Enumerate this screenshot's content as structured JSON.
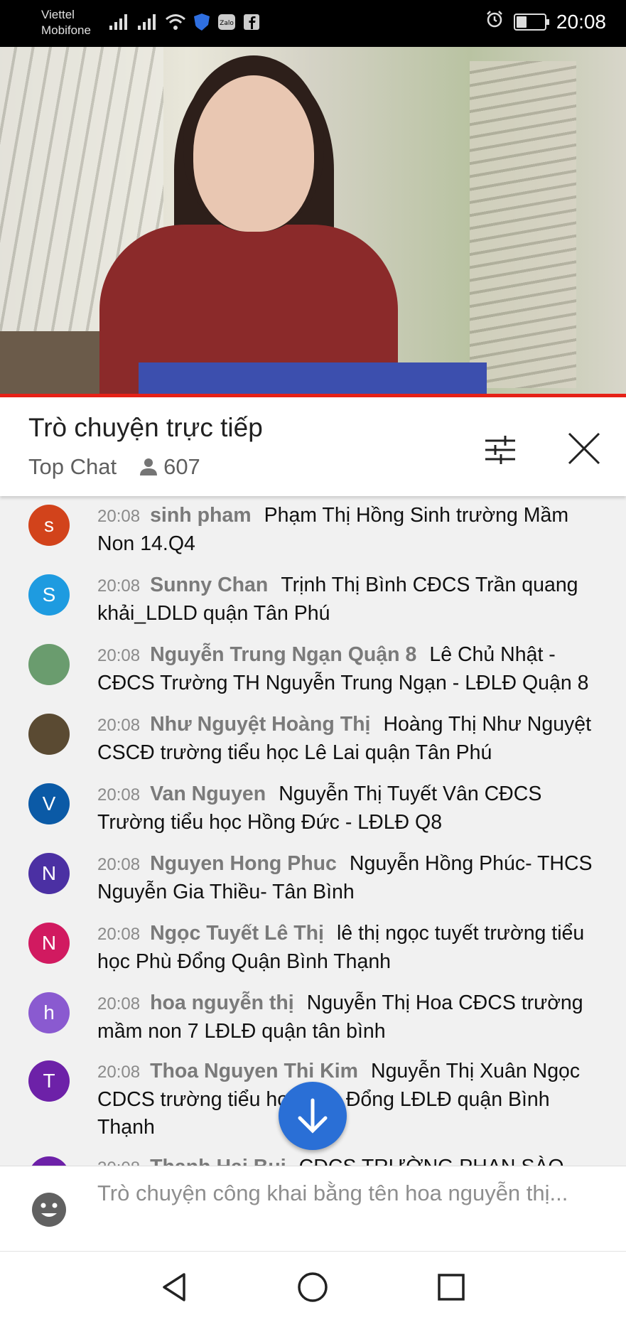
{
  "status_bar": {
    "carrier_1": "Viettel",
    "carrier_2": "Mobifone",
    "time": "20:08",
    "icons": [
      "signal-icon",
      "signal-icon",
      "wifi-icon",
      "shield-icon",
      "zalo-icon",
      "facebook-icon",
      "alarm-icon",
      "battery-icon"
    ]
  },
  "video": {
    "progress_color": "#e62117"
  },
  "chat_header": {
    "title": "Trò chuyện trực tiếp",
    "mode": "Top Chat",
    "viewer_count": "607"
  },
  "messages": [
    {
      "avatar_letter": "s",
      "avatar_color": "#d2431b",
      "time": "20:08",
      "author": "sinh pham",
      "text": "Phạm Thị Hồng Sinh trường Mầm Non 14.Q4"
    },
    {
      "avatar_letter": "S",
      "avatar_color": "#1e9be0",
      "time": "20:08",
      "author": "Sunny Chan",
      "text": "Trịnh Thị Bình CĐCS Trần quang khải_LDLD quận Tân Phú"
    },
    {
      "avatar_letter": "",
      "avatar_color": "#6a9c6e",
      "time": "20:08",
      "author": "Nguyễn Trung Ngạn Quận 8",
      "text": "Lê Chủ Nhật - CĐCS Trường TH Nguyễn Trung Ngạn - LĐLĐ Quận 8"
    },
    {
      "avatar_letter": "",
      "avatar_color": "#5a4a32",
      "time": "20:08",
      "author": "Như Nguyệt Hoàng Thị",
      "text": "Hoàng Thị Như Nguyệt CSCĐ trường tiểu học Lê Lai quận Tân Phú"
    },
    {
      "avatar_letter": "V",
      "avatar_color": "#0b5aa6",
      "time": "20:08",
      "author": "Van Nguyen",
      "text": "Nguyễn Thị Tuyết Vân CĐCS Trường tiểu học Hồng Đức - LĐLĐ Q8"
    },
    {
      "avatar_letter": "N",
      "avatar_color": "#4b30a3",
      "time": "20:08",
      "author": "Nguyen Hong Phuc",
      "text": "Nguyễn Hồng Phúc- THCS Nguyễn Gia Thiều- Tân Bình"
    },
    {
      "avatar_letter": "N",
      "avatar_color": "#d11a60",
      "time": "20:08",
      "author": "Ngọc Tuyết Lê Thị",
      "text": "lê thị ngọc tuyết trường tiểu học Phù Đổng Quận Bình Thạnh"
    },
    {
      "avatar_letter": "h",
      "avatar_color": "#8a5ad0",
      "time": "20:08",
      "author": "hoa nguyễn thị",
      "text": "Nguyễn Thị Hoa CĐCS trường mầm non 7 LĐLĐ quận tân bình"
    },
    {
      "avatar_letter": "T",
      "avatar_color": "#6d21a8",
      "time": "20:08",
      "author": "Thoa Nguyen Thi Kim",
      "text": "Nguyễn Thị Xuân Ngọc CDCS trường tiểu học Phù Đổng LĐLĐ quận Bình Thạnh"
    },
    {
      "avatar_letter": "",
      "avatar_color": "#6d21a8",
      "time": "20:08",
      "author": "Thanh Hai Bui",
      "text": "CĐCS TRƯỜNG PHAN SÀO"
    }
  ],
  "input": {
    "placeholder": "Trò chuyện công khai bằng tên hoa nguyễn thị..."
  },
  "colors": {
    "accent": "#2a6fd6",
    "header_bg": "#ffffff",
    "chat_bg": "#f1f1f1"
  }
}
